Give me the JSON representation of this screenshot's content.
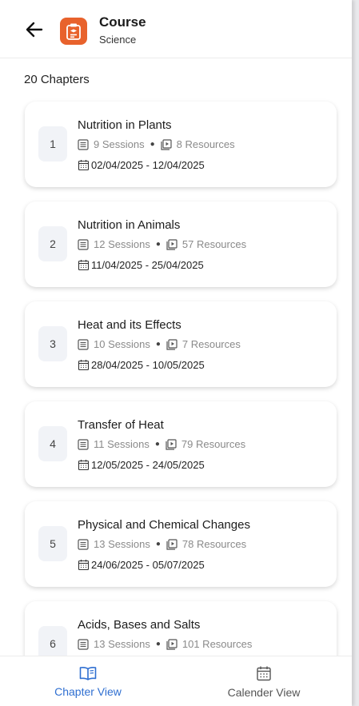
{
  "header": {
    "title": "Course",
    "subtitle": "Science",
    "icon": "course-icon",
    "icon_color": "#e8622c"
  },
  "chapter_count_label": "20 Chapters",
  "chapters": [
    {
      "num": "1",
      "title": "Nutrition in Plants",
      "sessions": "9 Sessions",
      "resources": "8 Resources",
      "dates": "02/04/2025 - 12/04/2025"
    },
    {
      "num": "2",
      "title": "Nutrition in Animals",
      "sessions": "12 Sessions",
      "resources": "57 Resources",
      "dates": "11/04/2025 - 25/04/2025"
    },
    {
      "num": "3",
      "title": "Heat and its Effects",
      "sessions": "10 Sessions",
      "resources": "7 Resources",
      "dates": "28/04/2025 - 10/05/2025"
    },
    {
      "num": "4",
      "title": "Transfer of Heat",
      "sessions": "11 Sessions",
      "resources": "79 Resources",
      "dates": "12/05/2025 - 24/05/2025"
    },
    {
      "num": "5",
      "title": "Physical and Chemical Changes",
      "sessions": "13 Sessions",
      "resources": "78 Resources",
      "dates": "24/06/2025 - 05/07/2025"
    },
    {
      "num": "6",
      "title": "Acids, Bases and Salts",
      "sessions": "13 Sessions",
      "resources": "101 Resources",
      "dates": ""
    }
  ],
  "bottom_nav": {
    "chapter_view": "Chapter View",
    "calendar_view": "Calender View",
    "active_color": "#2f6fd1",
    "inactive_color": "#555555"
  }
}
